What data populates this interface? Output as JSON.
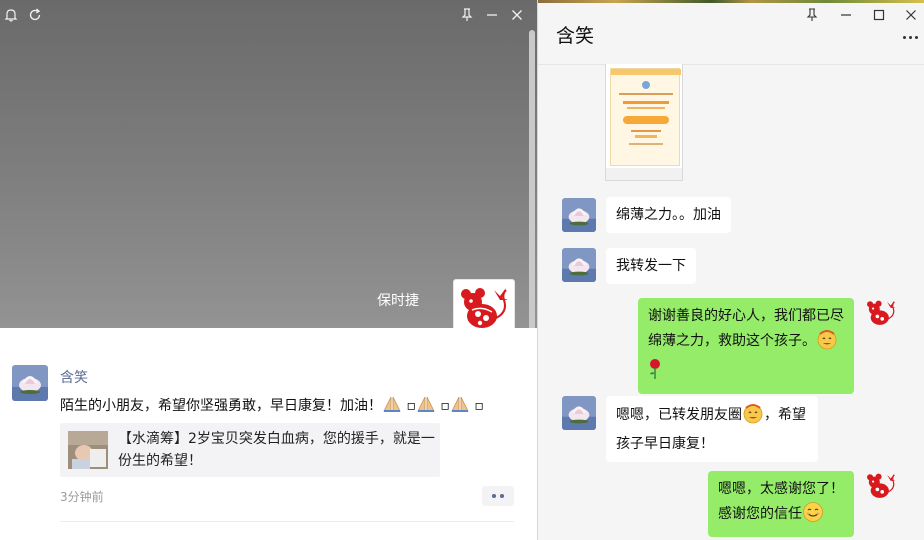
{
  "moments": {
    "cover_name": "保时捷",
    "post": {
      "author": "含笑",
      "text": "陌生的小朋友，希望你坚强勇敢，早日康复！加油！",
      "emojis": [
        "pray",
        "pray",
        "pray"
      ],
      "share_title": "【水滴筹】2岁宝贝突发白血病，您的援手，就是一份生的希望！",
      "time": "3分钟前"
    },
    "icons": {
      "bell": "bell-icon",
      "refresh": "refresh-icon",
      "pin": "pin-icon",
      "minimize": "minimize-icon",
      "close": "close-icon"
    }
  },
  "chat": {
    "title": "含笑",
    "messages": [
      {
        "from": "other",
        "type": "image",
        "label": "shared-screenshot"
      },
      {
        "from": "other",
        "text": "绵薄之力。。加油"
      },
      {
        "from": "other",
        "text": "我转发一下"
      },
      {
        "from": "me",
        "text": "谢谢善良的好心人，我们都已尽绵薄之力，救助这个孩子。",
        "emojis": [
          "happy",
          "rose"
        ]
      },
      {
        "from": "other",
        "text_a": "嗯嗯，已转发朋友圈",
        "text_b": "，希望孩子早日康复！",
        "emojis": [
          "happy"
        ]
      },
      {
        "from": "me",
        "text_a": "嗯嗯，太感谢您了！",
        "text_b": "感谢您的信任",
        "emojis": [
          "smile"
        ]
      }
    ],
    "icons": {
      "pin": "pin-icon",
      "minimize": "minimize-icon",
      "maximize": "maximize-icon",
      "close": "close-icon",
      "more": "more-icon"
    }
  },
  "colors": {
    "link_blue": "#576b95",
    "bubble_green": "#95ec69",
    "chat_bg": "#f5f5f5",
    "paper_cut_red": "#d8191e"
  }
}
